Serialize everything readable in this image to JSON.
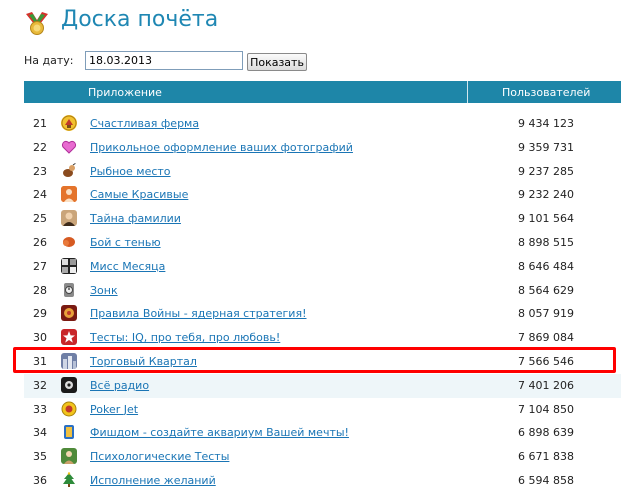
{
  "header": {
    "title": "Доска почёта"
  },
  "filter": {
    "date_label": "На дату:",
    "date_value": "18.03.2013",
    "show_button": "Показать"
  },
  "table": {
    "col_app": "Приложение",
    "col_users": "Пользователей",
    "rows": [
      {
        "rank": "21",
        "name": "Счастливая ферма",
        "users": "9 434 123",
        "icon": "farm-icon"
      },
      {
        "rank": "22",
        "name": "Прикольное оформление ваших фотографий",
        "users": "9 359 731",
        "icon": "heart-icon"
      },
      {
        "rank": "23",
        "name": "Рыбное место",
        "users": "9 237 285",
        "icon": "fishing-icon"
      },
      {
        "rank": "24",
        "name": "Самые Красивые",
        "users": "9 232 240",
        "icon": "beauty-icon"
      },
      {
        "rank": "25",
        "name": "Тайна фамилии",
        "users": "9 101 564",
        "icon": "portrait-icon"
      },
      {
        "rank": "26",
        "name": "Бой с тенью",
        "users": "8 898 515",
        "icon": "boxing-glove-icon"
      },
      {
        "rank": "27",
        "name": "Мисс Месяца",
        "users": "8 646 484",
        "icon": "collage-icon"
      },
      {
        "rank": "28",
        "name": "Зонк",
        "users": "8 564 629",
        "icon": "clock-icon"
      },
      {
        "rank": "29",
        "name": "Правила Войны - ядерная стратегия!",
        "users": "8 057 919",
        "icon": "war-icon"
      },
      {
        "rank": "30",
        "name": "Тесты: IQ, про тебя, про любовь!",
        "users": "7 869 084",
        "icon": "star-icon"
      },
      {
        "rank": "31",
        "name": "Торговый Квартал",
        "users": "7 566 546",
        "icon": "city-icon"
      },
      {
        "rank": "32",
        "name": "Всё радио",
        "users": "7 401 206",
        "icon": "radio-icon"
      },
      {
        "rank": "33",
        "name": "Poker Jet",
        "users": "7 104 850",
        "icon": "poker-chip-icon"
      },
      {
        "rank": "34",
        "name": "Фишдом - создайте аквариум Вашей мечты!",
        "users": "6 898 639",
        "icon": "aquarium-icon"
      },
      {
        "rank": "35",
        "name": "Психологические Тесты",
        "users": "6 671 838",
        "icon": "tests-icon"
      },
      {
        "rank": "36",
        "name": "Исполнение желаний",
        "users": "6 594 858",
        "icon": "tree-icon"
      }
    ]
  },
  "colors": {
    "accent": "#1e86a8",
    "title": "#1f87b3",
    "link": "#1a75b5",
    "highlight": "#ff0000"
  }
}
